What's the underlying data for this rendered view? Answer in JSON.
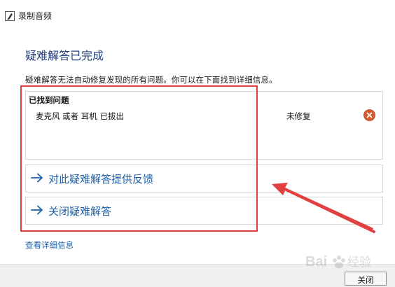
{
  "window": {
    "title": "录制音频"
  },
  "main": {
    "heading": "疑难解答已完成",
    "description": "疑难解答无法自动修复发现的所有问题。你可以在下面找到详细信息。"
  },
  "problems": {
    "header": "已找到问题",
    "items": [
      {
        "name": "麦克风 或者 耳机 已拔出",
        "status": "未修复",
        "status_icon": "error-icon"
      }
    ]
  },
  "links": {
    "feedback": "对此疑难解答提供反馈",
    "close_troubleshooter": "关闭疑难解答"
  },
  "view_details": "查看详细信息",
  "footer": {
    "close_button": "关闭"
  },
  "colors": {
    "link": "#1c5fa8",
    "heading": "#1f3d7a",
    "error_icon": "#d9592e",
    "annotation_red": "#e0403f"
  },
  "watermark": {
    "text": "Bai 经验"
  }
}
